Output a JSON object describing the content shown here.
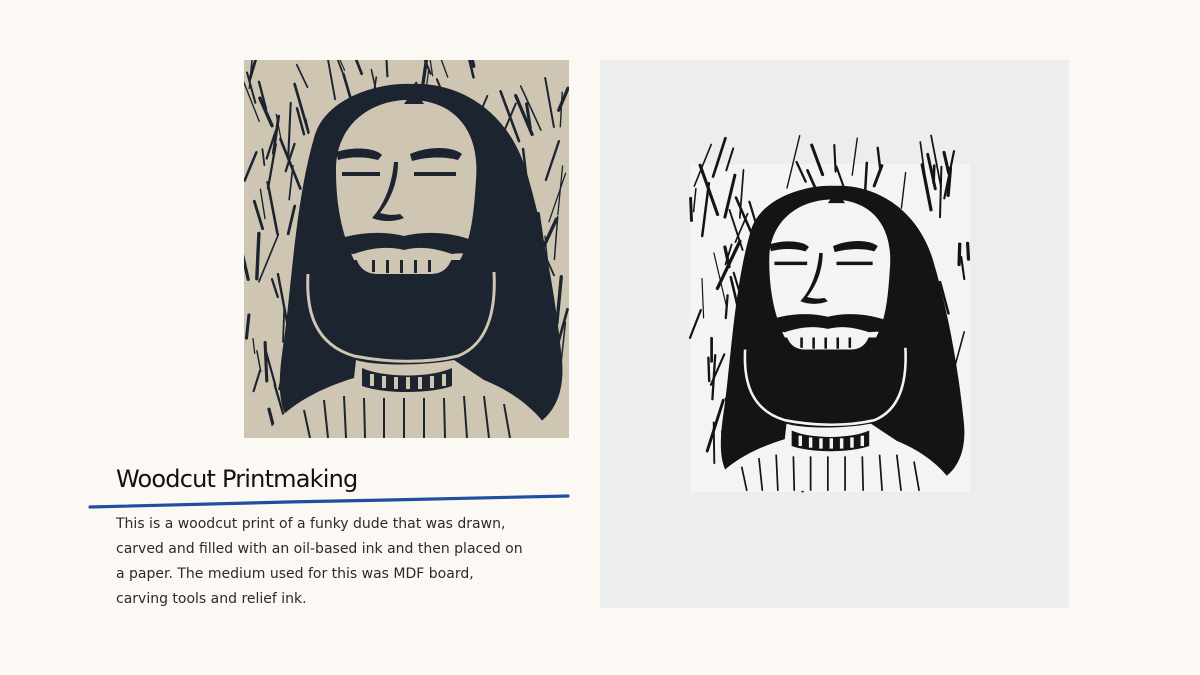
{
  "slide": {
    "title": "Woodcut Printmaking",
    "description": "This is a woodcut print of a funky dude that was drawn, carved and filled with an oil-based ink and then placed on a paper. The medium used for this was MDF board, carving tools and relief ink.",
    "accent_color": "#1f4ea3",
    "background_color": "#fcf8f4"
  },
  "images": {
    "block": {
      "subject": "carved MDF woodcut block with ink",
      "ink_color": "#1c2430",
      "board_color": "#cfc5b3"
    },
    "print": {
      "subject": "woodcut print on white paper",
      "ink_color": "#141414",
      "paper_color": "#eceded"
    }
  }
}
